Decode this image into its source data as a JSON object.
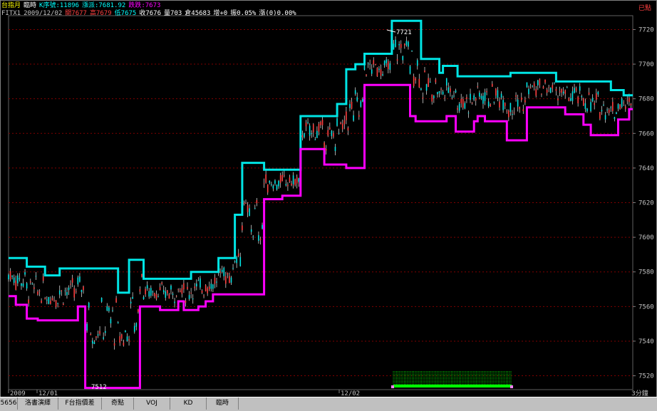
{
  "header": {
    "line1": [
      {
        "text": "台指月",
        "color": "#ffff00"
      },
      {
        "text": "臨時",
        "color": "#ffffff"
      },
      {
        "text": "K序號:11896",
        "color": "#00ffff"
      },
      {
        "text": "漲派:7681.92",
        "color": "#00ffff"
      },
      {
        "text": "跌跌:7673",
        "color": "#ff00ff"
      }
    ],
    "line2": [
      {
        "text": "FITX1",
        "color": "#c0c0c0"
      },
      {
        "text": "2009/12/02",
        "color": "#c0c0c0"
      },
      {
        "text": "開7677",
        "color": "#ff4040"
      },
      {
        "text": "高7679",
        "color": "#ff4040"
      },
      {
        "text": "低7675",
        "color": "#00ffff"
      },
      {
        "text": "收7676",
        "color": "#ffffff"
      },
      {
        "text": "量703",
        "color": "#ffffff"
      },
      {
        "text": "倉45683",
        "color": "#ffffff"
      },
      {
        "text": "增+0",
        "color": "#ffffff"
      },
      {
        "text": "振0.05%",
        "color": "#ffffff"
      },
      {
        "text": "漲(0)0.00%",
        "color": "#ffffff"
      }
    ]
  },
  "chart_data": {
    "type": "line",
    "title": "",
    "y_axis_labels": [
      "7720",
      "7700",
      "7680",
      "7660",
      "7640",
      "7620",
      "7600",
      "7580",
      "7560",
      "7540",
      "7520"
    ],
    "top_label": "已點",
    "ylim": [
      7512,
      7728
    ],
    "x_labels": [
      "2009",
      "12/01",
      "12/02"
    ],
    "timeframe_label": "3分鐘",
    "annotations": [
      {
        "text": "7721",
        "kind": "high"
      },
      {
        "text": "7512",
        "kind": "low"
      }
    ],
    "series": [
      {
        "color": "#00e5e5",
        "values": [
          [
            0,
            7588
          ],
          [
            10,
            7588
          ],
          [
            10,
            7583
          ],
          [
            20,
            7583
          ],
          [
            20,
            7578
          ],
          [
            28,
            7578
          ],
          [
            28,
            7582
          ],
          [
            60,
            7582
          ],
          [
            60,
            7568
          ],
          [
            66,
            7568
          ],
          [
            66,
            7587
          ],
          [
            74,
            7587
          ],
          [
            74,
            7576
          ],
          [
            100,
            7576
          ],
          [
            100,
            7580
          ],
          [
            115,
            7580
          ],
          [
            115,
            7588
          ],
          [
            124,
            7588
          ],
          [
            124,
            7613
          ],
          [
            128,
            7613
          ],
          [
            128,
            7643
          ],
          [
            140,
            7643
          ],
          [
            140,
            7639
          ],
          [
            160,
            7639
          ],
          [
            160,
            7670
          ],
          [
            180,
            7670
          ],
          [
            180,
            7677
          ],
          [
            185,
            7677
          ],
          [
            185,
            7697
          ],
          [
            190,
            7697
          ],
          [
            190,
            7700
          ],
          [
            195,
            7700
          ],
          [
            195,
            7706
          ],
          [
            210,
            7706
          ],
          [
            210,
            7725
          ],
          [
            226,
            7725
          ],
          [
            226,
            7703
          ],
          [
            236,
            7703
          ],
          [
            236,
            7695
          ],
          [
            238,
            7695
          ],
          [
            238,
            7699
          ],
          [
            246,
            7699
          ],
          [
            246,
            7693
          ],
          [
            275,
            7693
          ],
          [
            275,
            7695
          ],
          [
            300,
            7695
          ],
          [
            300,
            7690
          ],
          [
            330,
            7690
          ],
          [
            330,
            7685
          ],
          [
            337,
            7685
          ],
          [
            337,
            7682
          ],
          [
            342,
            7682
          ]
        ]
      },
      {
        "color": "#ff00ff",
        "values": [
          [
            0,
            7566
          ],
          [
            4,
            7566
          ],
          [
            4,
            7561
          ],
          [
            10,
            7561
          ],
          [
            10,
            7553
          ],
          [
            16,
            7553
          ],
          [
            16,
            7552
          ],
          [
            38,
            7552
          ],
          [
            38,
            7560
          ],
          [
            42,
            7560
          ],
          [
            42,
            7513
          ],
          [
            72,
            7513
          ],
          [
            72,
            7560
          ],
          [
            83,
            7560
          ],
          [
            83,
            7558
          ],
          [
            93,
            7558
          ],
          [
            93,
            7563
          ],
          [
            96,
            7563
          ],
          [
            96,
            7558
          ],
          [
            104,
            7558
          ],
          [
            104,
            7560
          ],
          [
            108,
            7560
          ],
          [
            108,
            7563
          ],
          [
            112,
            7563
          ],
          [
            112,
            7567
          ],
          [
            140,
            7567
          ],
          [
            140,
            7622
          ],
          [
            150,
            7622
          ],
          [
            150,
            7624
          ],
          [
            160,
            7624
          ],
          [
            160,
            7651
          ],
          [
            173,
            7651
          ],
          [
            173,
            7642
          ],
          [
            185,
            7642
          ],
          [
            185,
            7640
          ],
          [
            195,
            7640
          ],
          [
            195,
            7688
          ],
          [
            220,
            7688
          ],
          [
            220,
            7670
          ],
          [
            223,
            7670
          ],
          [
            223,
            7667
          ],
          [
            240,
            7667
          ],
          [
            240,
            7670
          ],
          [
            245,
            7670
          ],
          [
            245,
            7661
          ],
          [
            255,
            7661
          ],
          [
            255,
            7667
          ],
          [
            257,
            7667
          ],
          [
            257,
            7670
          ],
          [
            261,
            7670
          ],
          [
            261,
            7667
          ],
          [
            273,
            7667
          ],
          [
            273,
            7656
          ],
          [
            284,
            7656
          ],
          [
            284,
            7675
          ],
          [
            305,
            7675
          ],
          [
            305,
            7671
          ],
          [
            315,
            7671
          ],
          [
            315,
            7665
          ],
          [
            319,
            7665
          ],
          [
            319,
            7659
          ],
          [
            334,
            7659
          ],
          [
            334,
            7668
          ],
          [
            340,
            7668
          ],
          [
            340,
            7674
          ],
          [
            342,
            7674
          ]
        ]
      }
    ]
  },
  "tabs": [
    {
      "label": "5656"
    },
    {
      "label": "洛書演繹"
    },
    {
      "label": "F台指價差"
    },
    {
      "label": "奇點"
    },
    {
      "label": "VOJ"
    },
    {
      "label": "KD"
    },
    {
      "label": "臨時"
    }
  ]
}
